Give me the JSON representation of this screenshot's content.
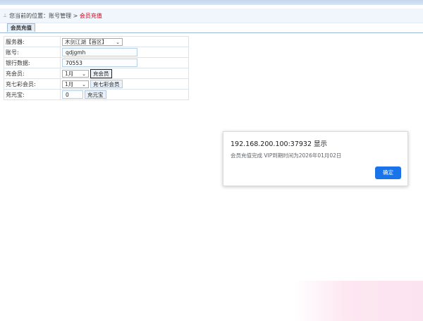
{
  "breadcrumb": {
    "prefix": "您当前的位置：账号管理 > ",
    "current": "会员充值"
  },
  "tab": {
    "label": "会员充值"
  },
  "form": {
    "server": {
      "label": "服务器:",
      "value": "木剑江湖【首区】"
    },
    "account": {
      "label": "账号:",
      "value": "qdjgmh"
    },
    "bank": {
      "label": "银行数据:",
      "value": "70553"
    },
    "vip": {
      "label": "充会员:",
      "month": "1月",
      "button": "充会员"
    },
    "vip7": {
      "label": "充七彩会员:",
      "month": "1月",
      "button": "充七彩会员"
    },
    "yuanbao": {
      "label": "充元宝:",
      "value": "0",
      "button": "充元宝"
    }
  },
  "dialog": {
    "title": "192.168.200.100:37932 显示",
    "message": "会员充值完成 VIP到期时间为2026年01月02日",
    "ok": "确定"
  }
}
